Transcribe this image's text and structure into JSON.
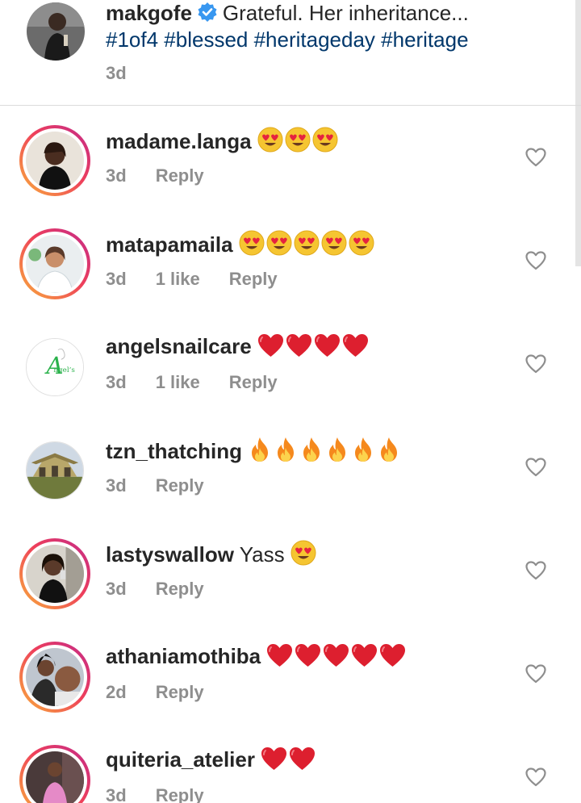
{
  "caption": {
    "username": "makgofe",
    "text": "Grateful. Her inheritance...",
    "hashtags": "#1of4 #blessed #heritageday #heritage",
    "time": "3d"
  },
  "comments": [
    {
      "username": "madame.langa",
      "text": "",
      "emoji": [
        "heart-eyes",
        "heart-eyes",
        "heart-eyes"
      ],
      "time": "3d",
      "likes": "",
      "reply": "Reply",
      "story_ring": true
    },
    {
      "username": "matapamaila",
      "text": "",
      "emoji": [
        "heart-eyes",
        "heart-eyes",
        "heart-eyes",
        "heart-eyes",
        "heart-eyes"
      ],
      "time": "3d",
      "likes": "1 like",
      "reply": "Reply",
      "story_ring": true
    },
    {
      "username": "angelsnailcare",
      "text": "",
      "emoji": [
        "red-heart",
        "red-heart",
        "red-heart",
        "red-heart"
      ],
      "time": "3d",
      "likes": "1 like",
      "reply": "Reply",
      "story_ring": false
    },
    {
      "username": "tzn_thatching",
      "text": "",
      "emoji": [
        "fire",
        "fire",
        "fire",
        "fire",
        "fire",
        "fire"
      ],
      "time": "3d",
      "likes": "",
      "reply": "Reply",
      "story_ring": false
    },
    {
      "username": "lastyswallow",
      "text": "Yass",
      "emoji": [
        "heart-eyes"
      ],
      "time": "3d",
      "likes": "",
      "reply": "Reply",
      "story_ring": true
    },
    {
      "username": "athaniamothiba",
      "text": "",
      "emoji": [
        "red-heart",
        "red-heart",
        "red-heart",
        "red-heart",
        "red-heart"
      ],
      "time": "2d",
      "likes": "",
      "reply": "Reply",
      "story_ring": true
    },
    {
      "username": "quiteria_atelier",
      "text": "",
      "emoji": [
        "red-heart",
        "red-heart"
      ],
      "time": "3d",
      "likes": "",
      "reply": "Reply",
      "story_ring": true
    }
  ],
  "colors": {
    "link": "#00376b",
    "muted": "#8e8e8e",
    "verified": "#3897f0"
  }
}
